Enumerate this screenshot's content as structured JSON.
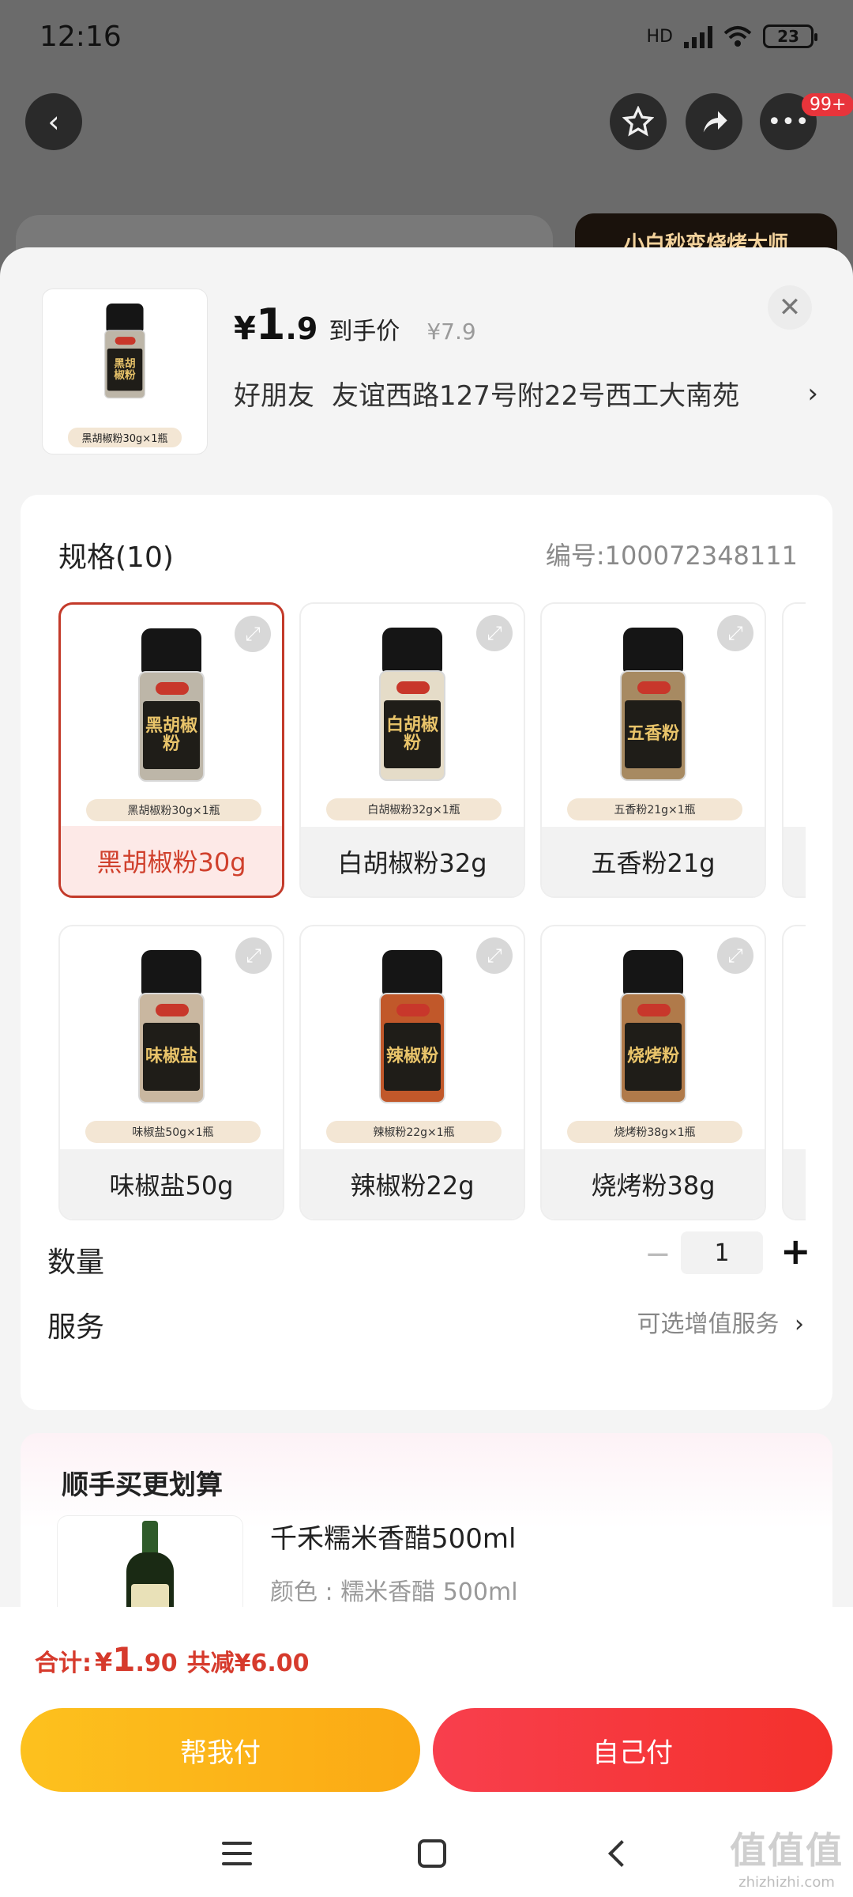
{
  "status_bar": {
    "time": "12:16",
    "network": "HD",
    "battery": "23"
  },
  "top_nav": {
    "badge": "99+"
  },
  "background_banner": "小白秒变烧烤大师",
  "product": {
    "price_yen": "¥",
    "price_int": "1",
    "price_dec": ".9",
    "price_label": "到手价",
    "original_price": "¥7.9",
    "thumb_pill": "黑胡椒粉30g×1瓶",
    "store_name": "好朋友",
    "address": "友谊西路127号附22号西工大南苑"
  },
  "specs": {
    "title": "规格(10)",
    "code": "编号:100072348111",
    "options": [
      {
        "label": "黑胡椒粉30g",
        "pill": "黑胡椒粉30g×1瓶",
        "bottle_text": "黑胡椒粉",
        "powder": "#bdb6a8",
        "selected": true
      },
      {
        "label": "白胡椒粉32g",
        "pill": "白胡椒粉32g×1瓶",
        "bottle_text": "白胡椒粉",
        "powder": "#e5dcc8",
        "selected": false
      },
      {
        "label": "五香粉21g",
        "pill": "五香粉21g×1瓶",
        "bottle_text": "五香粉",
        "powder": "#a78a62",
        "selected": false
      },
      {
        "label": "味椒盐50g",
        "pill": "味椒盐50g×1瓶",
        "bottle_text": "味椒盐",
        "powder": "#c9b7a0",
        "selected": false
      },
      {
        "label": "辣椒粉22g",
        "pill": "辣椒粉22g×1瓶",
        "bottle_text": "辣椒粉",
        "powder": "#c1582a",
        "selected": false
      },
      {
        "label": "烧烤粉38g",
        "pill": "烧烤粉38g×1瓶",
        "bottle_text": "烧烤粉",
        "powder": "#b07a4a",
        "selected": false
      }
    ]
  },
  "quantity": {
    "label": "数量",
    "value": "1",
    "minus": "−",
    "plus": "+"
  },
  "service": {
    "label": "服务",
    "value": "可选增值服务"
  },
  "combo": {
    "title": "顺手买更划算",
    "item_name": "千禾糯米香醋500ml",
    "item_attr": "颜色 : 糯米香醋 500ml"
  },
  "footer": {
    "total_label": "合计:",
    "total_yen": "¥",
    "total_int": "1",
    "total_dec": ".90",
    "discount": "共减¥6.00",
    "help_pay": "帮我付",
    "self_pay": "自己付"
  },
  "watermark": {
    "main": "值值值",
    "sub": "zhizhizhi.com"
  },
  "colors": {
    "accent_red": "#d63a2c",
    "help_yellow": "#fdb81a",
    "self_red": "#f5343a"
  }
}
